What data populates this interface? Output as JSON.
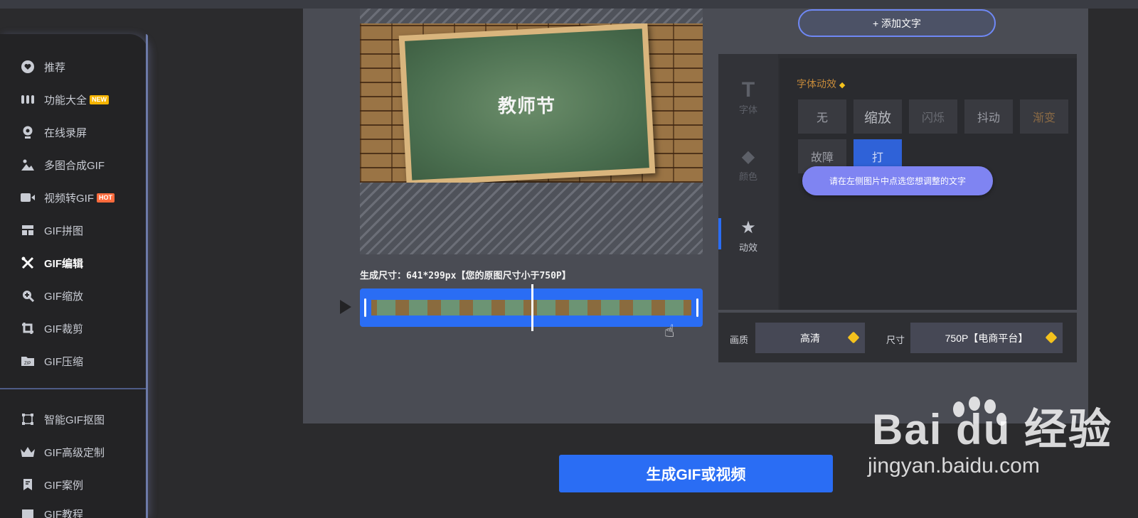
{
  "sidebar": {
    "items": [
      {
        "label": "推荐",
        "icon": "heart-icon"
      },
      {
        "label": "功能大全",
        "icon": "grid-icon",
        "badge": "NEW"
      },
      {
        "label": "在线录屏",
        "icon": "webcam-icon"
      },
      {
        "label": "多图合成GIF",
        "icon": "image-icon"
      },
      {
        "label": "视频转GIF",
        "icon": "video-camera-icon",
        "badge": "HOT"
      },
      {
        "label": "GIF拼图",
        "icon": "collage-icon"
      },
      {
        "label": "GIF编辑",
        "icon": "edit-tools-icon",
        "active": true
      },
      {
        "label": "GIF缩放",
        "icon": "zoom-icon"
      },
      {
        "label": "GIF裁剪",
        "icon": "crop-icon"
      },
      {
        "label": "GIF压缩",
        "icon": "zip-folder-icon"
      },
      {
        "label": "智能GIF抠图",
        "icon": "selection-icon"
      },
      {
        "label": "GIF高级定制",
        "icon": "crown-icon"
      },
      {
        "label": "GIF案例",
        "icon": "bookmark-icon"
      },
      {
        "label": "GIF教程",
        "icon": "book-icon"
      }
    ]
  },
  "editor": {
    "image_text": "教师节",
    "size_info": "生成尺寸：641*299px【您的原图尺寸小于750P】"
  },
  "right_panel": {
    "add_text_button": "+ 添加文字",
    "tabs": [
      {
        "label": "字体",
        "glyph": "T"
      },
      {
        "label": "颜色",
        "glyph": "◆"
      },
      {
        "label": "动效",
        "glyph": "★"
      }
    ],
    "effects_title": "字体动效",
    "effects": [
      "无",
      "缩放",
      "闪烁",
      "抖动",
      "渐变",
      "故障",
      "打"
    ],
    "tooltip": "请在左侧图片中点选您想调整的文字"
  },
  "settings": {
    "quality_label": "画质",
    "quality_value": "高清",
    "size_label": "尺寸",
    "size_value": "750P【电商平台】"
  },
  "generate_button": "生成GIF或视频",
  "watermark": {
    "logo_text": "Bai du 经验",
    "url": "jingyan.baidu.com"
  },
  "colors": {
    "accent": "#2a6df4",
    "tooltip": "#7f84f2",
    "gem": "#f4c21d"
  }
}
